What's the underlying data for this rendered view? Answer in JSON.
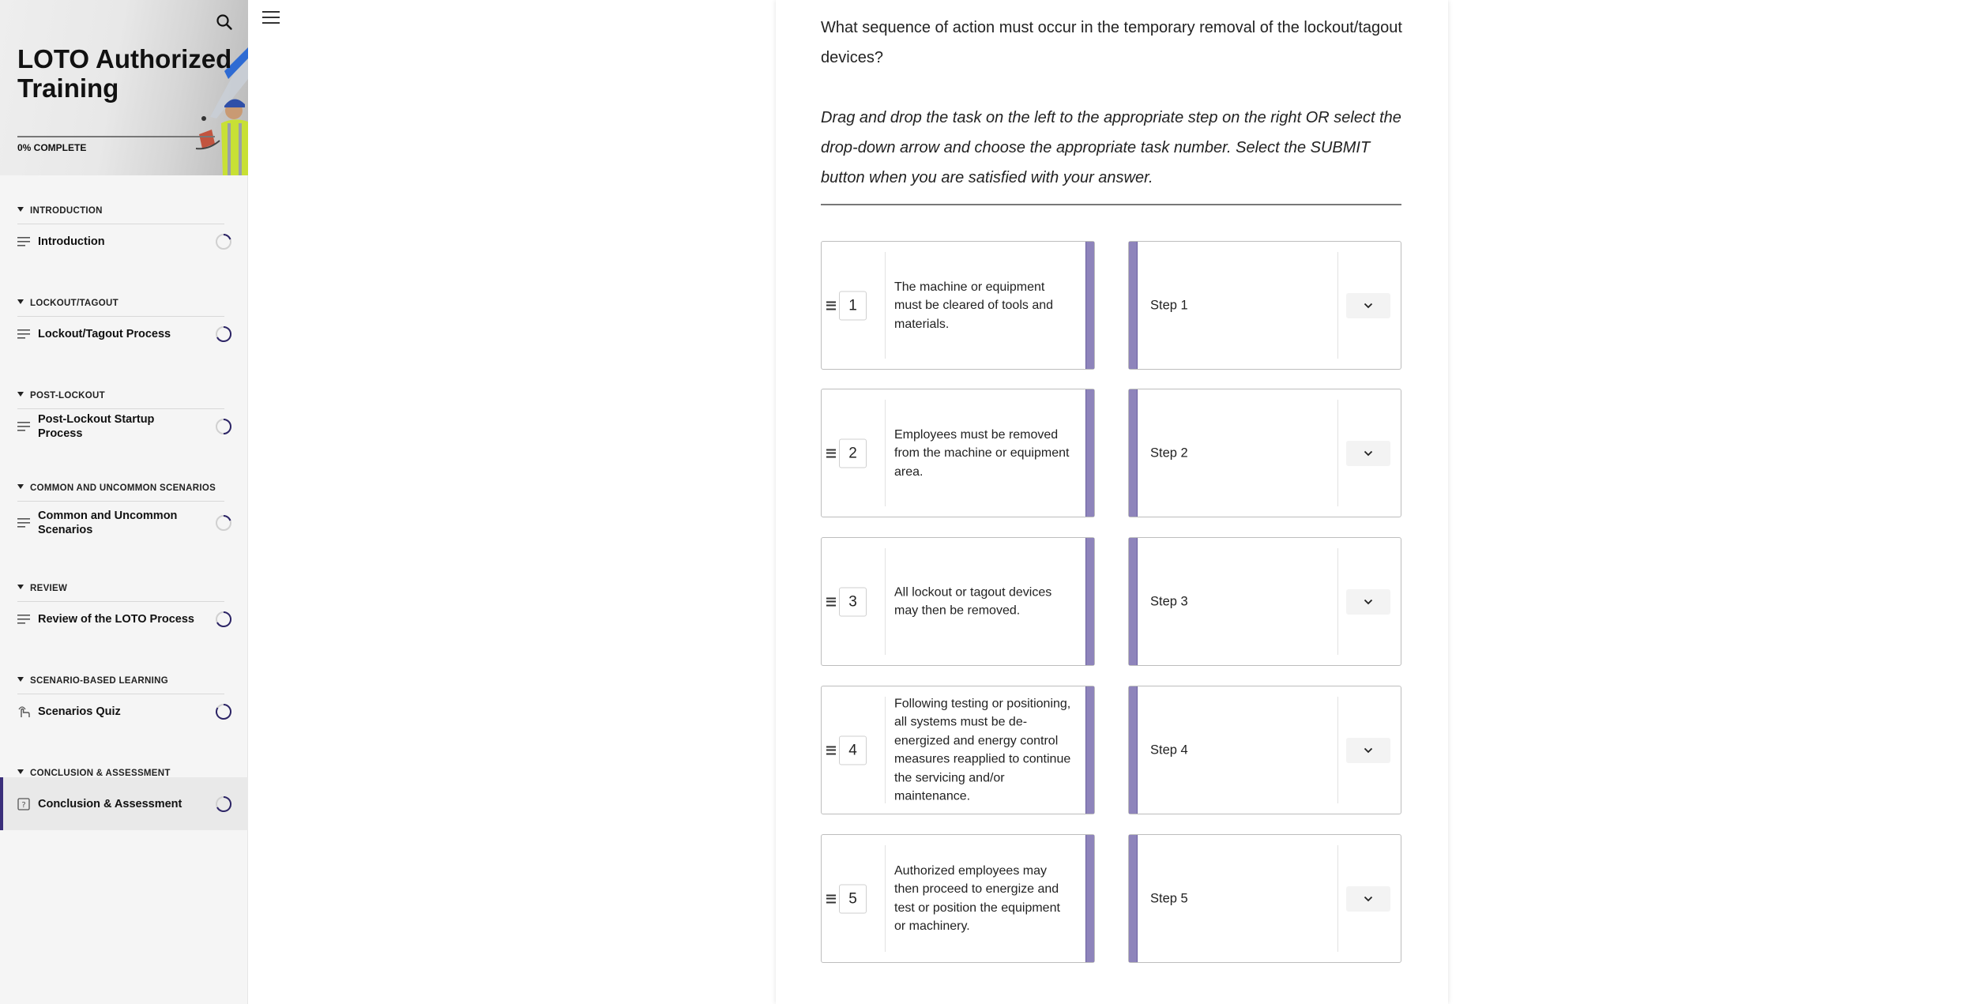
{
  "sidebar": {
    "title": "LOTO Authorized Training",
    "progress_text": "0% COMPLETE",
    "sections": [
      {
        "label": "INTRODUCTION",
        "item": "Introduction",
        "item_icon": "lines-icon",
        "status": "in-progress"
      },
      {
        "label": "LOCKOUT/TAGOUT",
        "item": "Lockout/Tagout Process",
        "item_icon": "lines-icon",
        "status": "in-progress"
      },
      {
        "label": "POST-LOCKOUT",
        "item": "Post-Lockout Startup Process",
        "item_icon": "lines-icon",
        "status": "in-progress"
      },
      {
        "label": "COMMON AND UNCOMMON SCENARIOS",
        "item": "Common and Uncommon Scenarios",
        "item_icon": "lines-icon",
        "status": "in-progress"
      },
      {
        "label": "REVIEW",
        "item": "Review of the LOTO Process",
        "item_icon": "lines-icon",
        "status": "in-progress"
      },
      {
        "label": "SCENARIO-BASED LEARNING",
        "item": "Scenarios Quiz",
        "item_icon": "hand-pointer-icon",
        "status": "in-progress"
      },
      {
        "label": "CONCLUSION & ASSESSMENT",
        "item": "Conclusion & Assessment",
        "item_icon": "question-box-icon",
        "status": "in-progress"
      }
    ]
  },
  "main": {
    "question": "What sequence of action must occur in the temporary removal of the lockout/tagout devices?",
    "instructions": "Drag and drop the task on the left to the appropriate step on the right OR select the drop-down arrow and choose the appropriate task number. Select the SUBMIT button when you are satisfied with your answer.",
    "tasks": [
      {
        "number": "1",
        "text": "The machine or equipment must be cleared of tools and materials."
      },
      {
        "number": "2",
        "text": "Employees must be removed from the machine or equipment area."
      },
      {
        "number": "3",
        "text": "All lockout or tagout devices may then be removed."
      },
      {
        "number": "4",
        "text": "Following testing or positioning, all systems must be de-energized and energy control measures reapplied to continue the servicing and/or maintenance."
      },
      {
        "number": "5",
        "text": "Authorized employees may then proceed to energize and test or position the equipment or machinery."
      }
    ],
    "steps": [
      {
        "label": "Step 1"
      },
      {
        "label": "Step 2"
      },
      {
        "label": "Step 3"
      },
      {
        "label": "Step 4"
      },
      {
        "label": "Step 5"
      }
    ]
  },
  "colors": {
    "accent": "#3a2e7a",
    "bar": "#8e84bb",
    "progress_ring": "#2c2466"
  }
}
